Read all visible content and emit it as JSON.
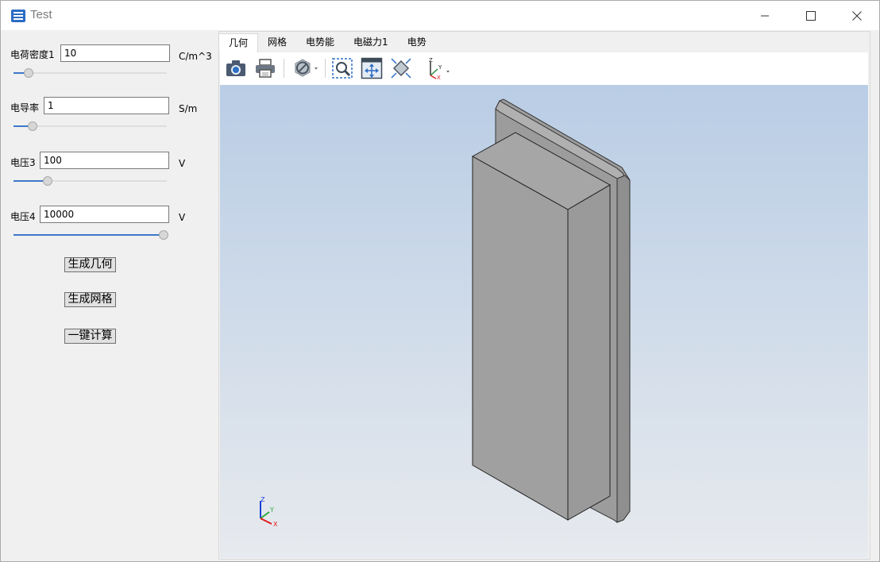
{
  "window": {
    "title": "Test"
  },
  "params": [
    {
      "label": "电荷密度1",
      "value": "10",
      "unit": "C/m^3",
      "slider_fraction": 0.07
    },
    {
      "label": "电导率",
      "value": "1",
      "unit": "S/m",
      "slider_fraction": 0.1
    },
    {
      "label": "电压3",
      "value": "100",
      "unit": "V",
      "slider_fraction": 0.2
    },
    {
      "label": "电压4",
      "value": "10000",
      "unit": "V",
      "slider_fraction": 1.0
    }
  ],
  "buttons": {
    "geometry": "生成几何",
    "mesh": "生成网格",
    "compute": "一键计算"
  },
  "tabs": [
    "几何",
    "网格",
    "电势能",
    "电磁力1",
    "电势"
  ],
  "active_tab": "几何",
  "toolbar_icons": [
    "camera-icon",
    "print-icon",
    "hide-icon",
    "zoom-box-icon",
    "zoom-extents-icon",
    "view-fit-icon",
    "view-axes-icon"
  ],
  "triad_labels": {
    "z": "Z",
    "y": "Y",
    "x": "X"
  },
  "colors": {
    "model_gray": "#a0a0a0",
    "accent": "#3c78c8",
    "bg_top": "#b9cde5",
    "bg_bottom": "#e7eaee"
  }
}
